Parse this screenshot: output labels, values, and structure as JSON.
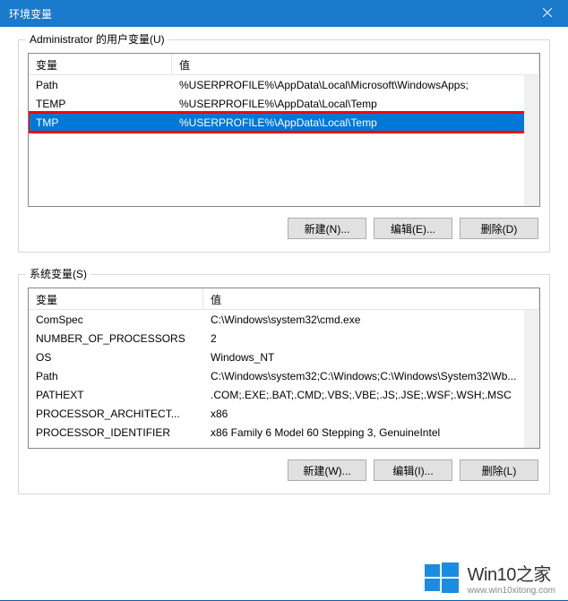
{
  "titlebar": {
    "title": "环境变量"
  },
  "user_vars": {
    "label": "Administrator 的用户变量(U)",
    "col_name": "变量",
    "col_value": "值",
    "rows": [
      {
        "name": "Path",
        "value": "%USERPROFILE%\\AppData\\Local\\Microsoft\\WindowsApps;"
      },
      {
        "name": "TEMP",
        "value": "%USERPROFILE%\\AppData\\Local\\Temp"
      },
      {
        "name": "TMP",
        "value": "%USERPROFILE%\\AppData\\Local\\Temp"
      }
    ],
    "buttons": {
      "new": "新建(N)...",
      "edit": "编辑(E)...",
      "delete": "删除(D)"
    }
  },
  "sys_vars": {
    "label": "系统变量(S)",
    "col_name": "变量",
    "col_value": "值",
    "rows": [
      {
        "name": "ComSpec",
        "value": "C:\\Windows\\system32\\cmd.exe"
      },
      {
        "name": "NUMBER_OF_PROCESSORS",
        "value": "2"
      },
      {
        "name": "OS",
        "value": "Windows_NT"
      },
      {
        "name": "Path",
        "value": "C:\\Windows\\system32;C:\\Windows;C:\\Windows\\System32\\Wb..."
      },
      {
        "name": "PATHEXT",
        "value": ".COM;.EXE;.BAT;.CMD;.VBS;.VBE;.JS;.JSE;.WSF;.WSH;.MSC"
      },
      {
        "name": "PROCESSOR_ARCHITECT...",
        "value": "x86"
      },
      {
        "name": "PROCESSOR_IDENTIFIER",
        "value": "x86 Family 6 Model 60 Stepping 3, GenuineIntel"
      }
    ],
    "buttons": {
      "new": "新建(W)...",
      "edit": "编辑(I)...",
      "delete": "删除(L)"
    }
  },
  "watermark": {
    "title": "Win10之家",
    "sub": "www.win10xitong.com"
  }
}
